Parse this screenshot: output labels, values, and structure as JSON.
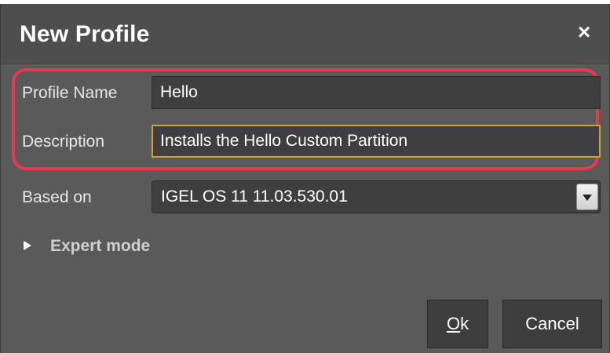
{
  "dialog": {
    "title": "New Profile",
    "close_symbol": "×"
  },
  "form": {
    "profile_name": {
      "label": "Profile Name",
      "value": "Hello"
    },
    "description": {
      "label": "Description",
      "value": "Installs the Hello Custom Partition"
    },
    "based_on": {
      "label": "Based on",
      "value": "IGEL OS 11 11.03.530.01"
    }
  },
  "expert_mode": {
    "label": "Expert mode",
    "icon": "triangle-right-icon"
  },
  "buttons": {
    "ok_mnemonic": "O",
    "ok_rest": "k",
    "cancel": "Cancel"
  },
  "colors": {
    "highlight": "#e8394d",
    "focus_border": "#c9a23b",
    "dialog_bg": "#5a5a5a"
  }
}
